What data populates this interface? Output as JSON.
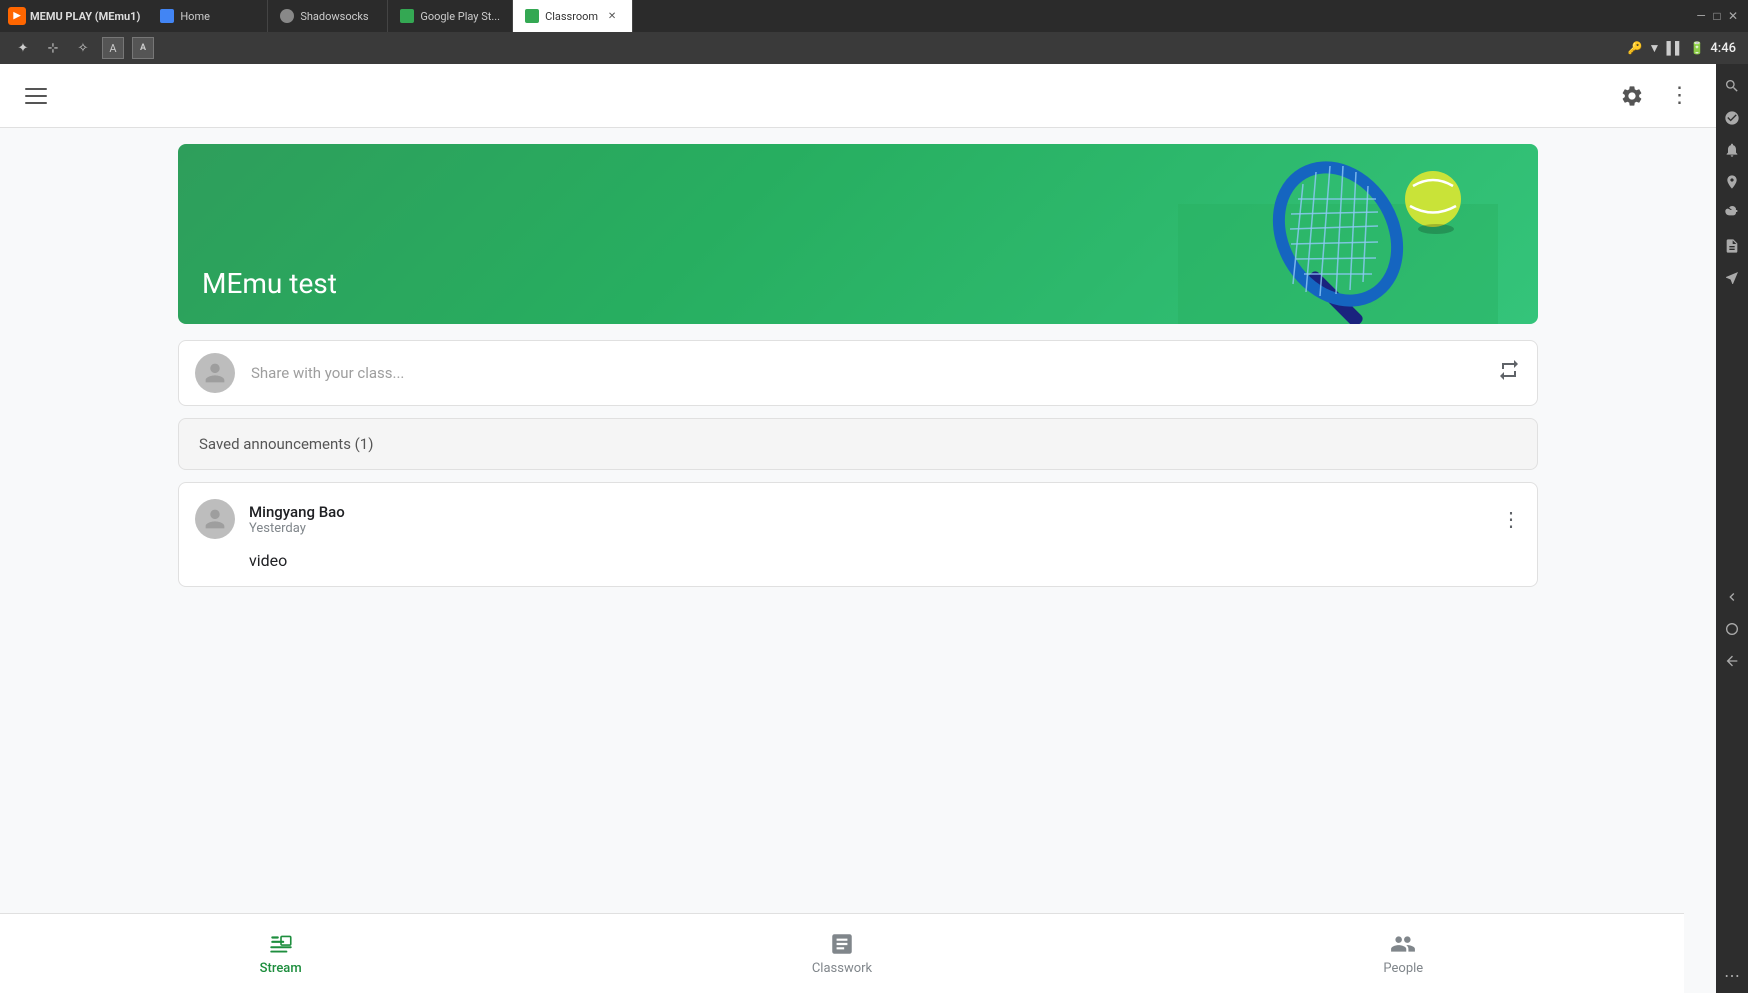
{
  "titlebar": {
    "app_name": "MEmu1",
    "tabs": [
      {
        "id": "home",
        "label": "Home",
        "favicon_color": "#4285f4",
        "active": false
      },
      {
        "id": "shadowsocks",
        "label": "Shadowsocks",
        "favicon_color": "#666",
        "active": false
      },
      {
        "id": "google-play",
        "label": "Google Play St...",
        "favicon_color": "#34a853",
        "active": false
      },
      {
        "id": "classroom",
        "label": "Classroom",
        "favicon_color": "#34a853",
        "active": true
      }
    ]
  },
  "system_bar": {
    "time": "4:46"
  },
  "app": {
    "course_title": "MEmu test",
    "share_placeholder": "Share with your class...",
    "saved_announcements": "Saved announcements (1)",
    "post": {
      "author": "Mingyang Bao",
      "time": "Yesterday",
      "content": "video"
    },
    "nav": {
      "stream": "Stream",
      "classwork": "Classwork",
      "people": "People"
    }
  }
}
